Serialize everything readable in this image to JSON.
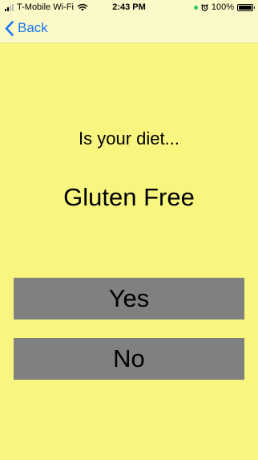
{
  "status_bar": {
    "carrier": "T-Mobile Wi-Fi",
    "time": "2:43 PM",
    "battery_percent": "100%",
    "battery_level": 1.0,
    "icons": [
      "signal-icon",
      "wifi-icon",
      "camera-indicator-icon",
      "alarm-icon",
      "battery-icon"
    ]
  },
  "nav": {
    "back_label": "Back",
    "accent_color": "#1677f3"
  },
  "content": {
    "question": "Is your diet...",
    "diet_name": "Gluten Free"
  },
  "buttons": {
    "yes_label": "Yes",
    "no_label": "No",
    "color": "#808080"
  },
  "colors": {
    "background": "#f8f67e",
    "bar_background": "#fbf9c8"
  }
}
